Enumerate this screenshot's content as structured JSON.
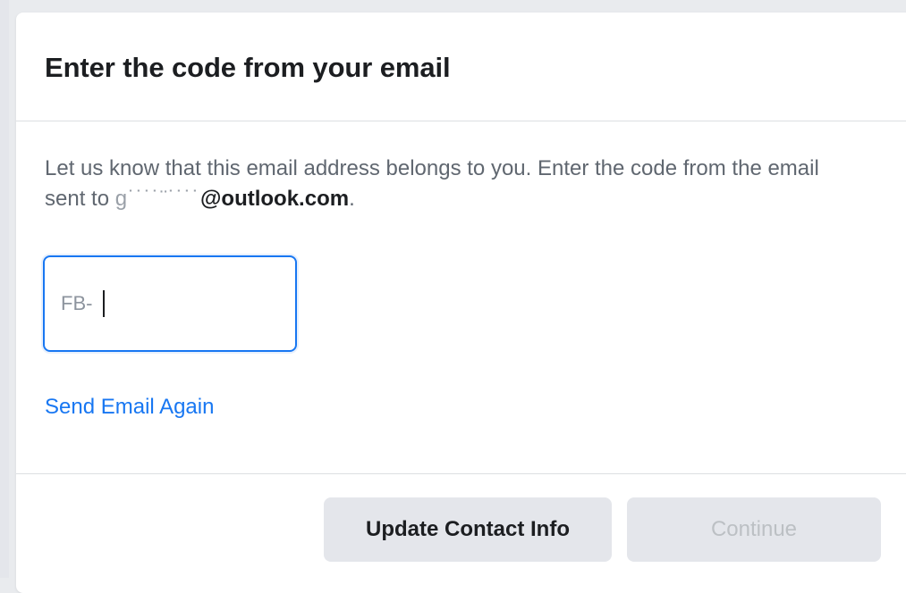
{
  "dialog": {
    "title": "Enter the code from your email",
    "description_prefix": "Let us know that this email address belongs to you. Enter the code from the email sent to ",
    "email_masked_part": "g˙˙˙˙¨˙˙˙˙",
    "email_domain_part": "@outlook.com",
    "description_suffix": "."
  },
  "code_input": {
    "prefix": "FB-",
    "value": ""
  },
  "links": {
    "send_again": "Send Email Again"
  },
  "buttons": {
    "update_contact": "Update Contact Info",
    "continue": "Continue"
  },
  "colors": {
    "accent": "#1877f2",
    "text_primary": "#1c1e21",
    "text_secondary": "#606770",
    "button_bg": "#e4e6eb",
    "button_disabled_text": "#bcc0c4"
  }
}
